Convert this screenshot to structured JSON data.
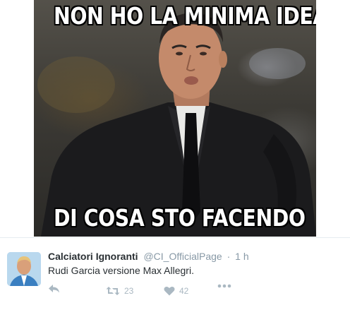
{
  "meme": {
    "top_caption": "NON HO LA MINIMA IDEA",
    "bottom_caption": "DI COSA STO FACENDO"
  },
  "tweet": {
    "author_name": "Calciatori Ignoranti",
    "author_handle": "@CI_OfficialPage",
    "separator": "·",
    "time": "1 h",
    "text": "Rudi Garcia versione Max Allegri.",
    "retweet_count": "23",
    "like_count": "42"
  },
  "icons": {
    "reply": "reply-icon",
    "retweet": "retweet-icon",
    "like": "heart-icon",
    "more": "more-icon"
  },
  "colors": {
    "muted_gray": "#aab8c2",
    "handle_gray": "#8899a6",
    "text_dark": "#292f33"
  }
}
